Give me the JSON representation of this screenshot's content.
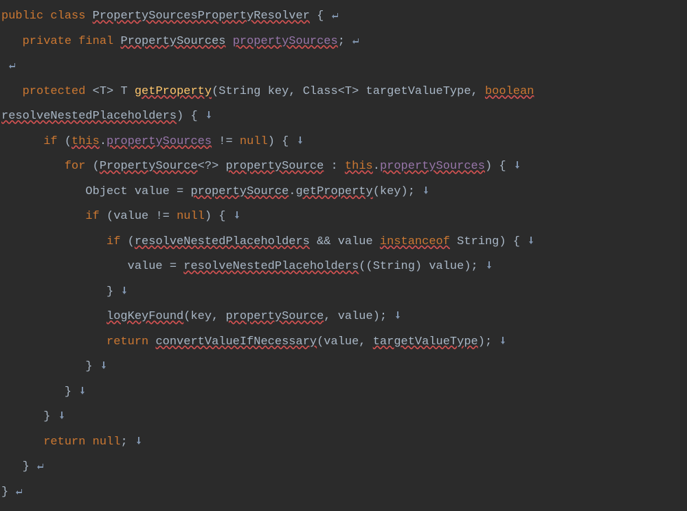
{
  "code": {
    "tokens": [
      [
        {
          "t": "public ",
          "c": "kw"
        },
        {
          "t": "class ",
          "c": "kw"
        },
        {
          "t": "PropertySourcesPropertyResolver",
          "c": "err"
        },
        {
          "t": " {",
          "c": ""
        },
        {
          "ws": "cr"
        }
      ],
      [
        {
          "t": "   ",
          "c": ""
        },
        {
          "t": "private ",
          "c": "kw"
        },
        {
          "t": "final ",
          "c": "kw"
        },
        {
          "t": "PropertySources",
          "c": "err"
        },
        {
          "t": " ",
          "c": ""
        },
        {
          "t": "propertySources",
          "c": "field err"
        },
        {
          "t": ";",
          "c": ""
        },
        {
          "ws": "cr"
        }
      ],
      [
        {
          "ws": "cr"
        }
      ],
      [
        {
          "t": "   ",
          "c": ""
        },
        {
          "t": "protected ",
          "c": "kw"
        },
        {
          "t": "<T> T",
          "c": ""
        },
        {
          "t": " ",
          "c": ""
        },
        {
          "t": "getProperty",
          "c": "method err"
        },
        {
          "t": "(String key, Class<T> targetValueType, ",
          "c": ""
        },
        {
          "t": "boolean",
          "c": "kw err"
        }
      ],
      [
        {
          "t": "resolveNestedPlaceholders",
          "c": "err"
        },
        {
          "t": ") {",
          "c": ""
        },
        {
          "ws": "down"
        }
      ],
      [
        {
          "t": "      ",
          "c": ""
        },
        {
          "t": "if ",
          "c": "kw"
        },
        {
          "t": "(",
          "c": ""
        },
        {
          "t": "this",
          "c": "this err"
        },
        {
          "t": ".",
          "c": ""
        },
        {
          "t": "propertySources",
          "c": "field err"
        },
        {
          "t": " != ",
          "c": ""
        },
        {
          "t": "null",
          "c": "kw"
        },
        {
          "t": ") {",
          "c": ""
        },
        {
          "ws": "down"
        }
      ],
      [
        {
          "t": "         ",
          "c": ""
        },
        {
          "t": "for ",
          "c": "kw"
        },
        {
          "t": "(",
          "c": ""
        },
        {
          "t": "PropertySource",
          "c": "err"
        },
        {
          "t": "<?> ",
          "c": ""
        },
        {
          "t": "propertySource",
          "c": "err"
        },
        {
          "t": " : ",
          "c": ""
        },
        {
          "t": "this",
          "c": "this err"
        },
        {
          "t": ".",
          "c": ""
        },
        {
          "t": "propertySources",
          "c": "field err"
        },
        {
          "t": ") {",
          "c": ""
        },
        {
          "ws": "down"
        }
      ],
      [
        {
          "t": "            Object value = ",
          "c": ""
        },
        {
          "t": "propertySource",
          "c": "err"
        },
        {
          "t": ".",
          "c": ""
        },
        {
          "t": "getProperty",
          "c": "err"
        },
        {
          "t": "(key);",
          "c": ""
        },
        {
          "ws": "down"
        }
      ],
      [
        {
          "t": "            ",
          "c": ""
        },
        {
          "t": "if ",
          "c": "kw"
        },
        {
          "t": "(value != ",
          "c": ""
        },
        {
          "t": "null",
          "c": "kw"
        },
        {
          "t": ") {",
          "c": ""
        },
        {
          "ws": "down"
        }
      ],
      [
        {
          "t": "               ",
          "c": ""
        },
        {
          "t": "if ",
          "c": "kw"
        },
        {
          "t": "(",
          "c": ""
        },
        {
          "t": "resolveNestedPlaceholders",
          "c": "err"
        },
        {
          "t": " && value ",
          "c": ""
        },
        {
          "t": "instanceof",
          "c": "kw err"
        },
        {
          "t": " String) {",
          "c": ""
        },
        {
          "ws": "down"
        }
      ],
      [
        {
          "t": "                  value = ",
          "c": ""
        },
        {
          "t": "resolveNestedPlaceholders",
          "c": "err"
        },
        {
          "t": "((String) value);",
          "c": ""
        },
        {
          "ws": "down"
        }
      ],
      [
        {
          "t": "               }",
          "c": ""
        },
        {
          "ws": "down"
        }
      ],
      [
        {
          "t": "               ",
          "c": ""
        },
        {
          "t": "logKeyFound",
          "c": "err"
        },
        {
          "t": "(key, ",
          "c": ""
        },
        {
          "t": "propertySource",
          "c": "err"
        },
        {
          "t": ", value);",
          "c": ""
        },
        {
          "ws": "down"
        }
      ],
      [
        {
          "t": "               ",
          "c": ""
        },
        {
          "t": "return ",
          "c": "kw"
        },
        {
          "t": "convertValueIfNecessary",
          "c": "err"
        },
        {
          "t": "(value, ",
          "c": ""
        },
        {
          "t": "targetValueType",
          "c": "err"
        },
        {
          "t": ");",
          "c": ""
        },
        {
          "ws": "down"
        }
      ],
      [
        {
          "t": "            }",
          "c": ""
        },
        {
          "ws": "down"
        }
      ],
      [
        {
          "t": "         }",
          "c": ""
        },
        {
          "ws": "down"
        }
      ],
      [
        {
          "t": "      }",
          "c": ""
        },
        {
          "ws": "down"
        }
      ],
      [
        {
          "t": "      ",
          "c": ""
        },
        {
          "t": "return ",
          "c": "kw"
        },
        {
          "t": "null",
          "c": "kw"
        },
        {
          "t": ";",
          "c": ""
        },
        {
          "ws": "down"
        }
      ],
      [
        {
          "t": "   }",
          "c": ""
        },
        {
          "ws": "cr"
        }
      ],
      [
        {
          "t": "}",
          "c": ""
        },
        {
          "ws": "cr"
        }
      ]
    ]
  },
  "icons": {
    "cr_glyph": "↵",
    "down_glyph": "↓"
  }
}
